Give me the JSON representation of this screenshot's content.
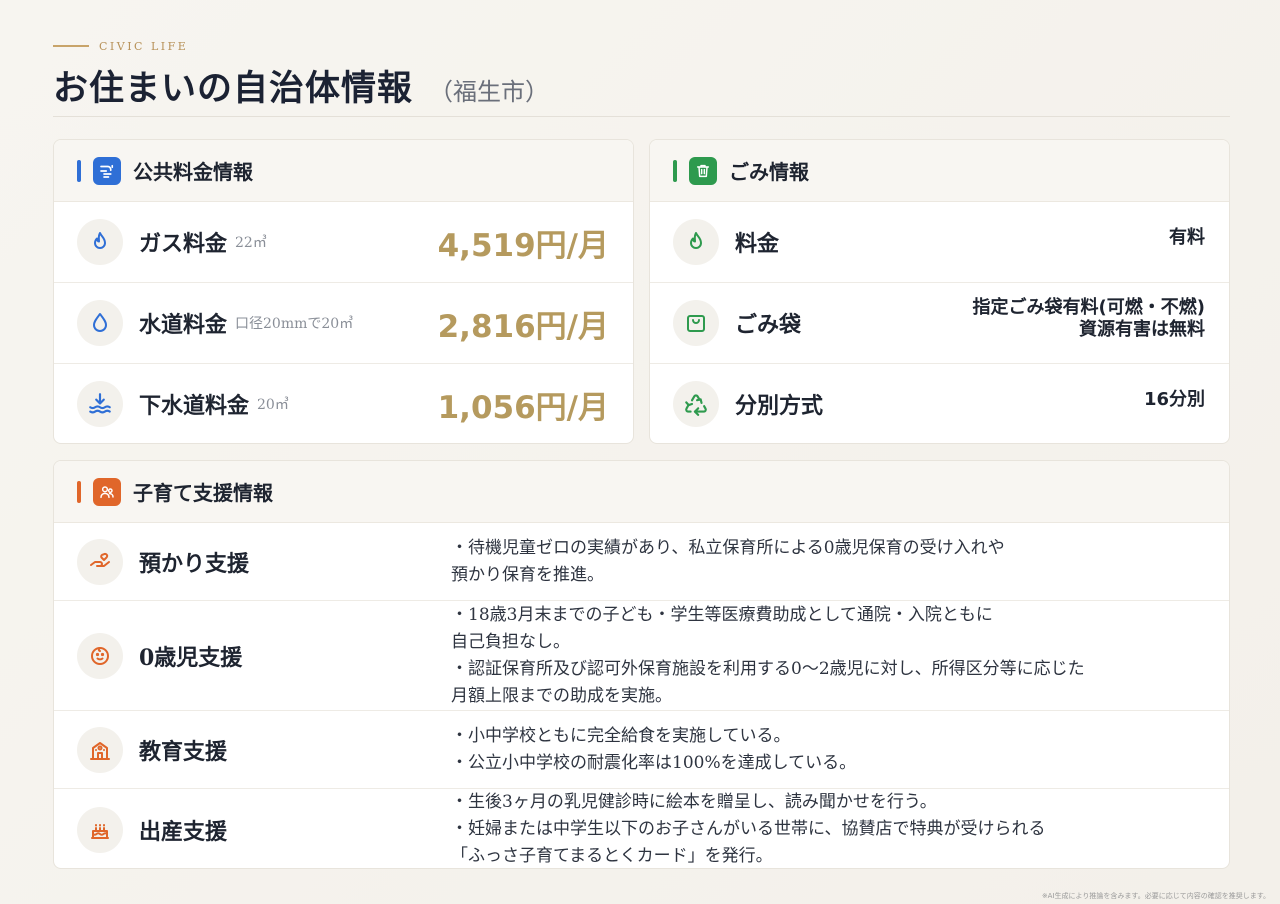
{
  "header": {
    "eyebrow": "CIVIC LIFE",
    "title": "お住まいの自治体情報",
    "city": "（福生市）"
  },
  "utilities": {
    "title": "公共料金情報",
    "accent": "#2f6fd6",
    "items": [
      {
        "icon": "flame-icon",
        "label": "ガス料金",
        "note": "22㎥",
        "value": "4,519円/月"
      },
      {
        "icon": "water-drop-icon",
        "label": "水道料金",
        "note": "口径20mmで20㎥",
        "value": "2,816円/月"
      },
      {
        "icon": "sewer-icon",
        "label": "下水道料金",
        "note": "20㎥",
        "value": "1,056円/月"
      }
    ]
  },
  "garbage": {
    "title": "ごみ情報",
    "accent": "#2e9a4e",
    "items": [
      {
        "icon": "flame-icon",
        "label": "料金",
        "value_lines": [
          "有料"
        ]
      },
      {
        "icon": "bag-icon",
        "label": "ごみ袋",
        "value_lines": [
          "指定ごみ袋有料(可燃・不燃)",
          "資源有害は無料"
        ]
      },
      {
        "icon": "recycle-icon",
        "label": "分別方式",
        "value_lines": [
          "16分別"
        ]
      }
    ]
  },
  "childcare": {
    "title": "子育て支援情報",
    "accent": "#e0662a",
    "items": [
      {
        "icon": "hand-heart-icon",
        "label": "預かり支援",
        "lines": [
          "・待機児童ゼロの実績があり、私立保育所による0歳児保育の受け入れや",
          "預かり保育を推進。"
        ]
      },
      {
        "icon": "baby-icon",
        "label": "0歳児支援",
        "lines": [
          "・18歳3月末までの子ども・学生等医療費助成として通院・入院ともに",
          "自己負担なし。",
          "・認証保育所及び認可外保育施設を利用する0～2歳児に対し、所得区分等に応じた",
          "月額上限までの助成を実施。"
        ]
      },
      {
        "icon": "school-icon",
        "label": "教育支援",
        "lines": [
          "・小中学校ともに完全給食を実施している。",
          "・公立小中学校の耐震化率は100%を達成している。"
        ]
      },
      {
        "icon": "cake-icon",
        "label": "出産支援",
        "lines": [
          "・生後3ヶ月の乳児健診時に絵本を贈呈し、読み聞かせを行う。",
          "・妊婦または中学生以下のお子さんがいる世帯に、協賛店で特典が受けられる",
          "「ふっさ子育てまるとくカード」を発行。"
        ]
      }
    ]
  },
  "footnote": "※AI生成により推論を含みます。必要に応じて内容の確認を推奨します。"
}
